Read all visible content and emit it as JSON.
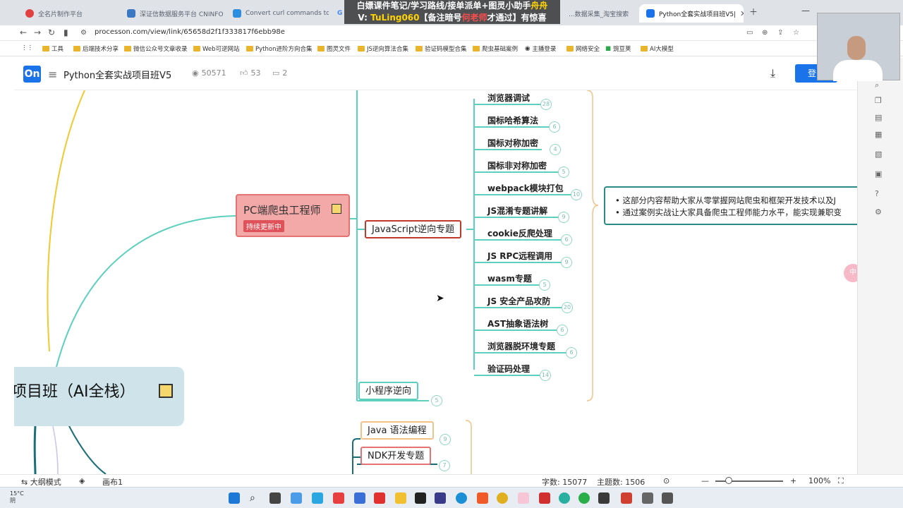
{
  "browser": {
    "tabs": [
      {
        "label": "全名片制作平台",
        "color": "#e04040"
      },
      {
        "label": "深证信数据服务平台 CNINFO",
        "color": "#3b78c4"
      },
      {
        "label": "Convert curl commands to c",
        "color": "#2d8ee0"
      },
      {
        "label": "G",
        "color": "#4285f4"
      },
      {
        "label": "...数据采集_淘宝搜索",
        "color": "#f08030"
      },
      {
        "label": "Python全套实战项目班V5|",
        "color": "#1a73e8"
      }
    ],
    "url": "processon.com/view/link/65658d2f1f333817f6ebb98e",
    "bookmarks": [
      "工具",
      "后端技术分享",
      "微信公众号文章收录",
      "Web可逆网站",
      "Python进阶方向合集",
      "图灵文件",
      "JS逆向算法合集",
      "验证码模型合集",
      "爬虫基础案例",
      "主播登录",
      "网络安全",
      "豌豆荚",
      "AI大模型"
    ]
  },
  "banner": {
    "line1": "白嫖课件笔记/学习路线/接单派单+图灵小助手",
    "line1_highlight": "舟舟",
    "line2_prefix": "V: ",
    "line2_id": "TuLing060",
    "line2_mid": "【备注暗号",
    "line2_code": "何老师",
    "line2_suffix": "才通过】有惊喜"
  },
  "app": {
    "logo": "On",
    "title": "Python全套实战项目班V5",
    "views": "50571",
    "likes": "53",
    "comments": "2",
    "login_label": "登"
  },
  "mindmap": {
    "root": "项目班（AI全栈）",
    "pc_node": {
      "label": "PC端爬虫工程师",
      "tag": "持续更新中"
    },
    "js_node": "JavaScript逆向专题",
    "mini_node": "小程序逆向",
    "mini_count": "5",
    "java_node": "Java 语法编程",
    "java_count": "9",
    "ndk_node": "NDK开发专题",
    "ndk_count": "7",
    "js_children": [
      {
        "label": "浏览器调试",
        "count": "28"
      },
      {
        "label": "国标哈希算法",
        "count": "6"
      },
      {
        "label": "国标对称加密",
        "count": "4"
      },
      {
        "label": "国标非对称加密",
        "count": "5"
      },
      {
        "label": "webpack模块打包",
        "count": "10"
      },
      {
        "label": "JS混淆专题讲解",
        "count": "9"
      },
      {
        "label": "cookie反爬处理",
        "count": "6"
      },
      {
        "label": "JS RPC远程调用",
        "count": "9"
      },
      {
        "label": "wasm专题",
        "count": "5"
      },
      {
        "label": "JS 安全产品攻防",
        "count": "20"
      },
      {
        "label": "AST抽象语法树",
        "count": "6"
      },
      {
        "label": "浏览器脱环境专题",
        "count": "6"
      },
      {
        "label": "验证码处理",
        "count": "14"
      }
    ],
    "description": [
      "这部分内容帮助大家从零掌握网站爬虫和框架开发技术以及J",
      "通过案例实战让大家具备爬虫工程师能力水平，能实现兼职变"
    ],
    "float_label": "中"
  },
  "statusbar": {
    "outline_mode": "大纲模式",
    "canvas": "画布1",
    "word_count": "字数: 15077",
    "topic_count": "主题数: 1506",
    "zoom": "100%",
    "zoom_fraction": 0.2
  },
  "taskbar": {
    "temperature": "15°C",
    "weather": "阴"
  }
}
